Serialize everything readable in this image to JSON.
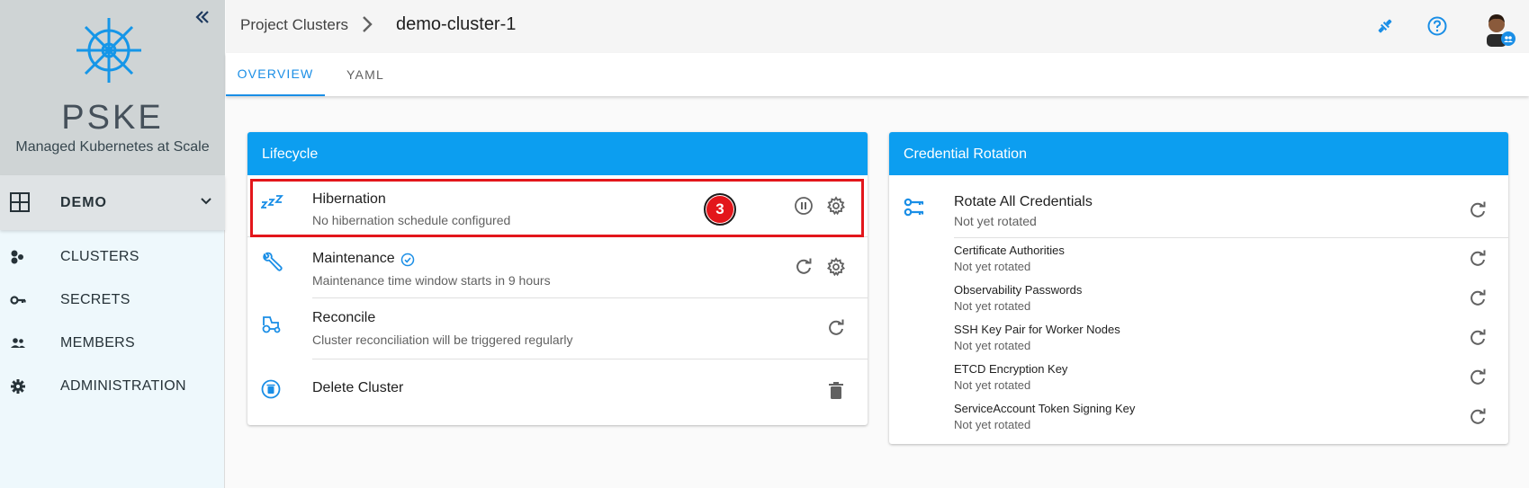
{
  "sidebar": {
    "brand_title": "PSKE",
    "brand_subtitle": "Managed Kubernetes at Scale",
    "project": "DEMO",
    "items": [
      {
        "label": "CLUSTERS",
        "icon": "clusters-icon"
      },
      {
        "label": "SECRETS",
        "icon": "key-icon"
      },
      {
        "label": "MEMBERS",
        "icon": "members-icon"
      },
      {
        "label": "ADMINISTRATION",
        "icon": "gear-icon"
      }
    ]
  },
  "header": {
    "breadcrumb_parent": "Project Clusters",
    "breadcrumb_current": "demo-cluster-1"
  },
  "tabs": [
    {
      "label": "OVERVIEW",
      "active": true
    },
    {
      "label": "YAML",
      "active": false
    }
  ],
  "lifecycle": {
    "title": "Lifecycle",
    "rows": [
      {
        "title": "Hibernation",
        "subtitle": "No hibernation schedule configured",
        "icon": "sleep-icon"
      },
      {
        "title": "Maintenance",
        "subtitle": "Maintenance time window starts in 9 hours",
        "icon": "wrench-icon"
      },
      {
        "title": "Reconcile",
        "subtitle": "Cluster reconciliation will be triggered regularly",
        "icon": "tractor-icon"
      },
      {
        "title": "Delete Cluster",
        "subtitle": "",
        "icon": "delete-circle-icon"
      }
    ]
  },
  "annotation_badge": "3",
  "credential_rotation": {
    "title": "Credential Rotation",
    "all": {
      "title": "Rotate All Credentials",
      "status": "Not yet rotated"
    },
    "items": [
      {
        "title": "Certificate Authorities",
        "status": "Not yet rotated"
      },
      {
        "title": "Observability Passwords",
        "status": "Not yet rotated"
      },
      {
        "title": "SSH Key Pair for Worker Nodes",
        "status": "Not yet rotated"
      },
      {
        "title": "ETCD Encryption Key",
        "status": "Not yet rotated"
      },
      {
        "title": "ServiceAccount Token Signing Key",
        "status": "Not yet rotated"
      }
    ]
  },
  "colors": {
    "accent": "#0c9ef0",
    "highlight": "#e3161b",
    "sidebar_bg": "#eef8fc",
    "brand_bg": "#cfd4d5"
  }
}
